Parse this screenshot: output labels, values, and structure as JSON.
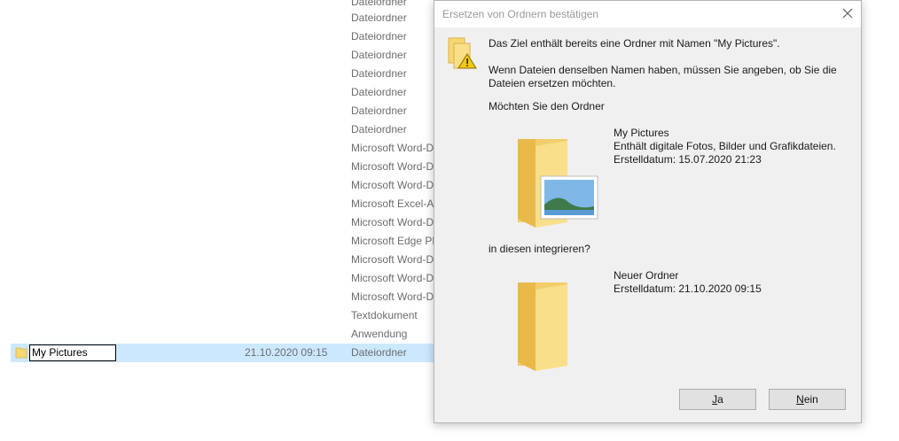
{
  "explorer": {
    "types": [
      "Dateiordner",
      "Dateiordner",
      "Dateiordner",
      "Dateiordner",
      "Dateiordner",
      "Dateiordner",
      "Dateiordner",
      "Dateiordner",
      "Microsoft Word-D",
      "Microsoft Word-D",
      "Microsoft Word-D",
      "Microsoft Excel-A",
      "Microsoft Word-D",
      "Microsoft Edge PD",
      "Microsoft Word-D",
      "Microsoft Word-D",
      "Microsoft Word-D",
      "Textdokument",
      "Anwendung"
    ],
    "selected_row": {
      "name": "My Pictures",
      "date": "21.10.2020 09:15",
      "type": "Dateiordner"
    }
  },
  "dialog": {
    "title": "Ersetzen von Ordnern bestätigen",
    "message1": "Das Ziel enthält bereits eine Ordner mit Namen \"My Pictures\".",
    "message2_line1": "Wenn Dateien denselben Namen haben, müssen Sie angeben, ob Sie die",
    "message2_line2": "Dateien ersetzen möchten.",
    "question": "Möchten Sie den Ordner",
    "source": {
      "name": "My Pictures",
      "description": "Enthält digitale Fotos, Bilder und Grafikdateien.",
      "created": "Erstelldatum: 15.07.2020 21:23"
    },
    "merge_text": "in diesen integrieren?",
    "target": {
      "name": "Neuer Ordner",
      "created": "Erstelldatum: 21.10.2020 09:15"
    },
    "yes_accel": "J",
    "yes_rest": "a",
    "no_accel": "N",
    "no_rest": "ein"
  },
  "icons": {
    "main": "folder-warning-icon",
    "source": "pictures-folder-icon",
    "target": "folder-icon",
    "close": "close-icon"
  },
  "colors": {
    "selection": "#cce8ff",
    "dialog_bg": "#f0f0f0",
    "folder": "#f7d774"
  }
}
